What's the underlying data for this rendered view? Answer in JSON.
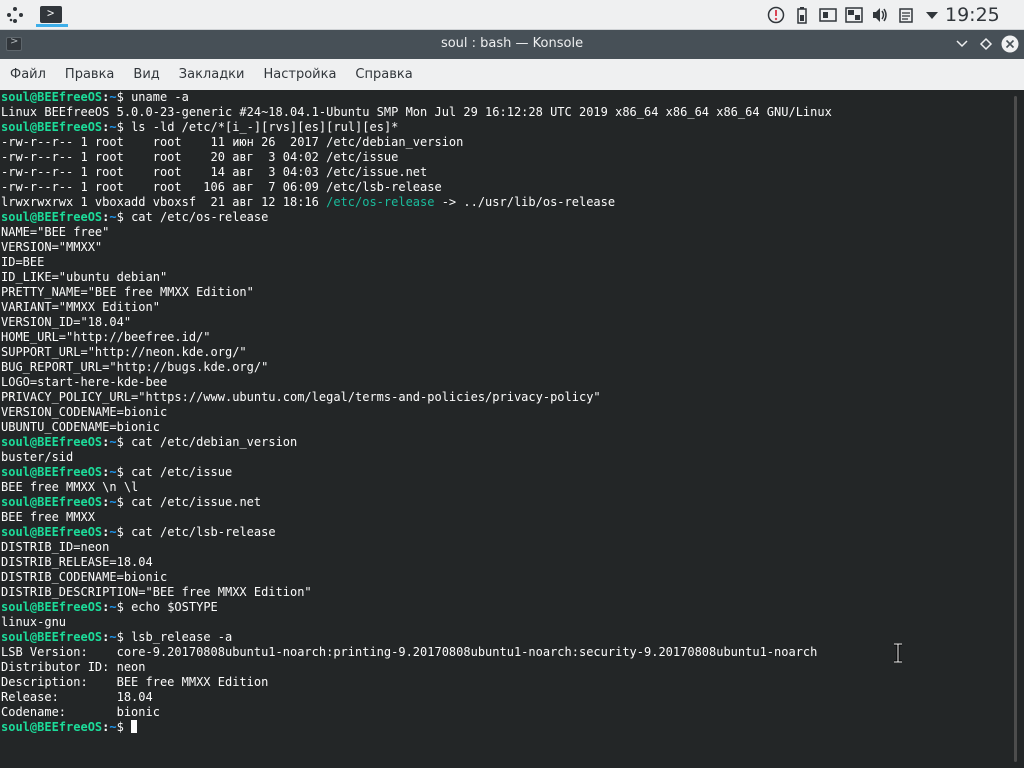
{
  "panel": {
    "clock": "19:25",
    "tray_icons": [
      "network-icon",
      "battery-icon",
      "clipboard-icon",
      "device-icon",
      "volume-icon",
      "notes-icon",
      "expand-tray-icon"
    ]
  },
  "window": {
    "title": "soul : bash — Konsole"
  },
  "menu": {
    "items": [
      "Файл",
      "Правка",
      "Вид",
      "Закладки",
      "Настройка",
      "Справка"
    ]
  },
  "prompt": {
    "user": "soul@BEEfreeOS",
    "colon": ":",
    "path": "~",
    "dollar": "$ "
  },
  "terminal": {
    "lines": [
      {
        "type": "cmd",
        "cmd": "uname -a"
      },
      {
        "type": "out",
        "text": "Linux BEEfreeOS 5.0.0-23-generic #24~18.04.1-Ubuntu SMP Mon Jul 29 16:12:28 UTC 2019 x86_64 x86_64 x86_64 GNU/Linux"
      },
      {
        "type": "cmd",
        "cmd": "ls -ld /etc/*[i_-][rvs][es][rul][es]*"
      },
      {
        "type": "out",
        "text": "-rw-r--r-- 1 root    root    11 июн 26  2017 /etc/debian_version"
      },
      {
        "type": "out",
        "text": "-rw-r--r-- 1 root    root    20 авг  3 04:02 /etc/issue"
      },
      {
        "type": "out",
        "text": "-rw-r--r-- 1 root    root    14 авг  3 04:03 /etc/issue.net"
      },
      {
        "type": "out",
        "text": "-rw-r--r-- 1 root    root   106 авг  7 06:09 /etc/lsb-release"
      },
      {
        "type": "link",
        "pre": "lrwxrwxrwx 1 vboxadd vboxsf  21 авг 12 18:16 ",
        "link": "/etc/os-release",
        "post": " -> ../usr/lib/os-release"
      },
      {
        "type": "cmd",
        "cmd": "cat /etc/os-release"
      },
      {
        "type": "out",
        "text": "NAME=\"BEE free\""
      },
      {
        "type": "out",
        "text": "VERSION=\"MMXX\""
      },
      {
        "type": "out",
        "text": "ID=BEE"
      },
      {
        "type": "out",
        "text": "ID_LIKE=\"ubuntu debian\""
      },
      {
        "type": "out",
        "text": "PRETTY_NAME=\"BEE free MMXX Edition\""
      },
      {
        "type": "out",
        "text": "VARIANT=\"MMXX Edition\""
      },
      {
        "type": "out",
        "text": "VERSION_ID=\"18.04\""
      },
      {
        "type": "out",
        "text": "HOME_URL=\"http://beefree.id/\""
      },
      {
        "type": "out",
        "text": "SUPPORT_URL=\"http://neon.kde.org/\""
      },
      {
        "type": "out",
        "text": "BUG_REPORT_URL=\"http://bugs.kde.org/\""
      },
      {
        "type": "out",
        "text": "LOGO=start-here-kde-bee"
      },
      {
        "type": "out",
        "text": "PRIVACY_POLICY_URL=\"https://www.ubuntu.com/legal/terms-and-policies/privacy-policy\""
      },
      {
        "type": "out",
        "text": "VERSION_CODENAME=bionic"
      },
      {
        "type": "out",
        "text": "UBUNTU_CODENAME=bionic"
      },
      {
        "type": "cmd",
        "cmd": "cat /etc/debian_version"
      },
      {
        "type": "out",
        "text": "buster/sid"
      },
      {
        "type": "cmd",
        "cmd": "cat /etc/issue"
      },
      {
        "type": "out",
        "text": "BEE free MMXX \\n \\l"
      },
      {
        "type": "cmd",
        "cmd": "cat /etc/issue.net"
      },
      {
        "type": "out",
        "text": "BEE free MMXX"
      },
      {
        "type": "cmd",
        "cmd": "cat /etc/lsb-release"
      },
      {
        "type": "out",
        "text": "DISTRIB_ID=neon"
      },
      {
        "type": "out",
        "text": "DISTRIB_RELEASE=18.04"
      },
      {
        "type": "out",
        "text": "DISTRIB_CODENAME=bionic"
      },
      {
        "type": "out",
        "text": "DISTRIB_DESCRIPTION=\"BEE free MMXX Edition\""
      },
      {
        "type": "cmd",
        "cmd": "echo $OSTYPE"
      },
      {
        "type": "out",
        "text": "linux-gnu"
      },
      {
        "type": "cmd",
        "cmd": "lsb_release -a"
      },
      {
        "type": "out",
        "text": "LSB Version:\tcore-9.20170808ubuntu1-noarch:printing-9.20170808ubuntu1-noarch:security-9.20170808ubuntu1-noarch"
      },
      {
        "type": "out",
        "text": "Distributor ID:\tneon"
      },
      {
        "type": "out",
        "text": "Description:\tBEE free MMXX Edition"
      },
      {
        "type": "out",
        "text": "Release:\t18.04"
      },
      {
        "type": "out",
        "text": "Codename:\tbionic"
      },
      {
        "type": "cursor",
        "cmd": ""
      }
    ]
  },
  "colors": {
    "prompt_user": "#1cdc9a",
    "prompt_path": "#1d99f3",
    "symlink": "#1abc9c",
    "background": "#232627",
    "foreground": "#fcfcfc",
    "accent": "#3daee9"
  }
}
